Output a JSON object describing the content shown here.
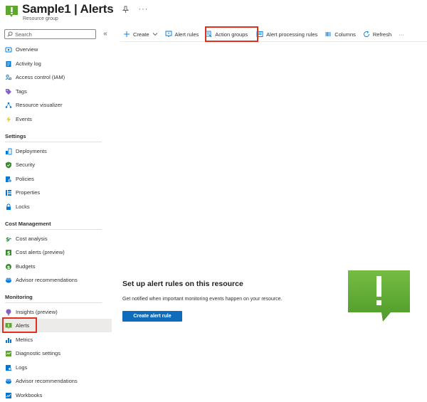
{
  "header": {
    "title": "Sample1 | Alerts",
    "subtitle": "Resource group",
    "more": "···"
  },
  "sidebar": {
    "search_placeholder": "Search",
    "collapse": "«",
    "items_top": [
      {
        "label": "Overview",
        "icon": "overview-icon"
      },
      {
        "label": "Activity log",
        "icon": "activity-log-icon"
      },
      {
        "label": "Access control (IAM)",
        "icon": "access-control-icon"
      },
      {
        "label": "Tags",
        "icon": "tag-icon"
      },
      {
        "label": "Resource visualizer",
        "icon": "resource-visualizer-icon"
      },
      {
        "label": "Events",
        "icon": "lightning-icon"
      }
    ],
    "sections": [
      {
        "title": "Settings",
        "items": [
          {
            "label": "Deployments",
            "icon": "deployments-icon"
          },
          {
            "label": "Security",
            "icon": "shield-icon"
          },
          {
            "label": "Policies",
            "icon": "policies-icon"
          },
          {
            "label": "Properties",
            "icon": "properties-icon"
          },
          {
            "label": "Locks",
            "icon": "lock-icon"
          }
        ]
      },
      {
        "title": "Cost Management",
        "items": [
          {
            "label": "Cost analysis",
            "icon": "cost-analysis-icon"
          },
          {
            "label": "Cost alerts (preview)",
            "icon": "cost-alerts-icon"
          },
          {
            "label": "Budgets",
            "icon": "budgets-icon"
          },
          {
            "label": "Advisor recommendations",
            "icon": "advisor-icon"
          }
        ]
      },
      {
        "title": "Monitoring",
        "items": [
          {
            "label": "Insights (preview)",
            "icon": "insights-icon"
          },
          {
            "label": "Alerts",
            "icon": "alerts-icon",
            "selected": true
          },
          {
            "label": "Metrics",
            "icon": "metrics-icon"
          },
          {
            "label": "Diagnostic settings",
            "icon": "diagnostic-settings-icon"
          },
          {
            "label": "Logs",
            "icon": "logs-icon"
          },
          {
            "label": "Advisor recommendations",
            "icon": "advisor-icon"
          },
          {
            "label": "Workbooks",
            "icon": "workbooks-icon"
          }
        ]
      }
    ]
  },
  "toolbar": {
    "create": "Create",
    "alert_rules": "Alert rules",
    "action_groups": "Action groups",
    "alert_processing_rules": "Alert processing rules",
    "columns": "Columns",
    "refresh": "Refresh",
    "more": "···"
  },
  "empty_state": {
    "title": "Set up alert rules on this resource",
    "description": "Get notified when important monitoring events happen on your resource.",
    "button": "Create alert rule"
  },
  "colors": {
    "accent": "#0f6cbd",
    "highlight": "#e0301e",
    "alert_green": "#5ea62f"
  }
}
